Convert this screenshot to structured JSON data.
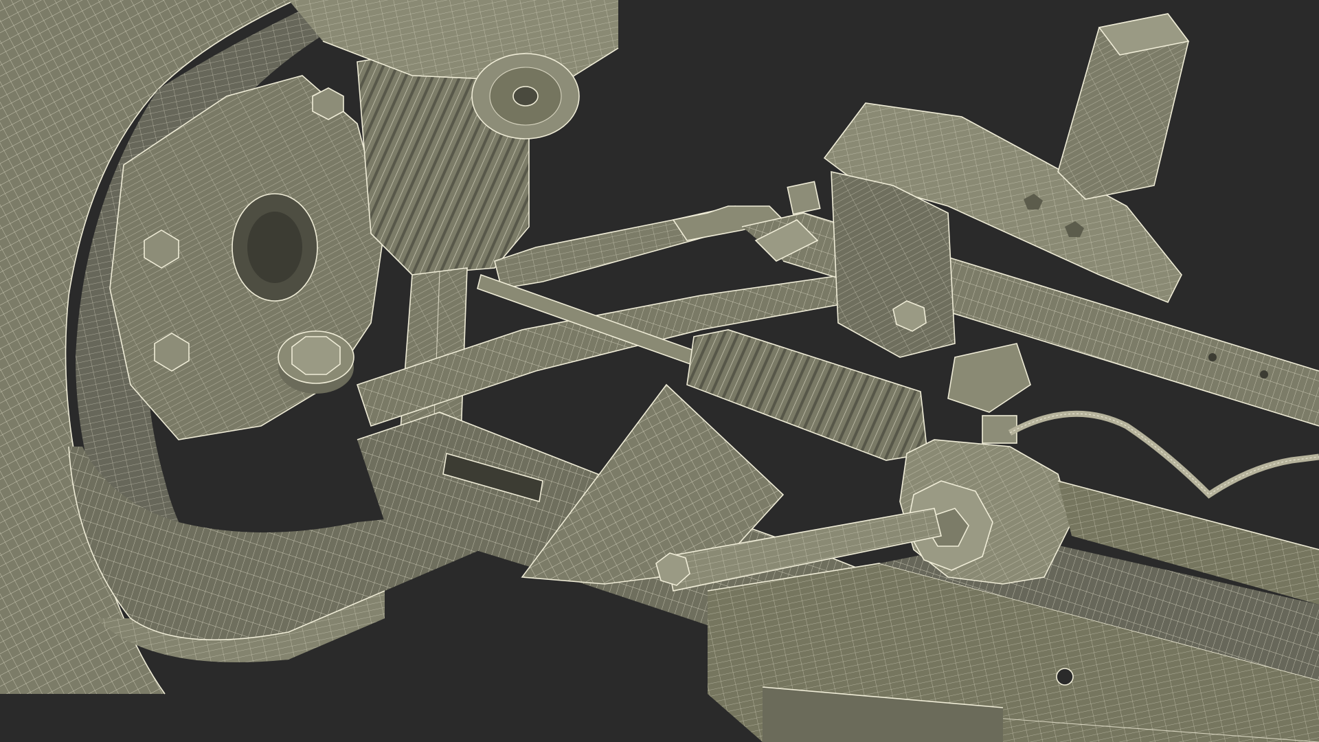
{
  "scene": {
    "background_color": "#2a2a2a",
    "mesh_fill_light": "#8a8a74",
    "mesh_fill_mid": "#727260",
    "mesh_fill_dark": "#5c5c4c",
    "wire_color": "#e6e3cf"
  }
}
